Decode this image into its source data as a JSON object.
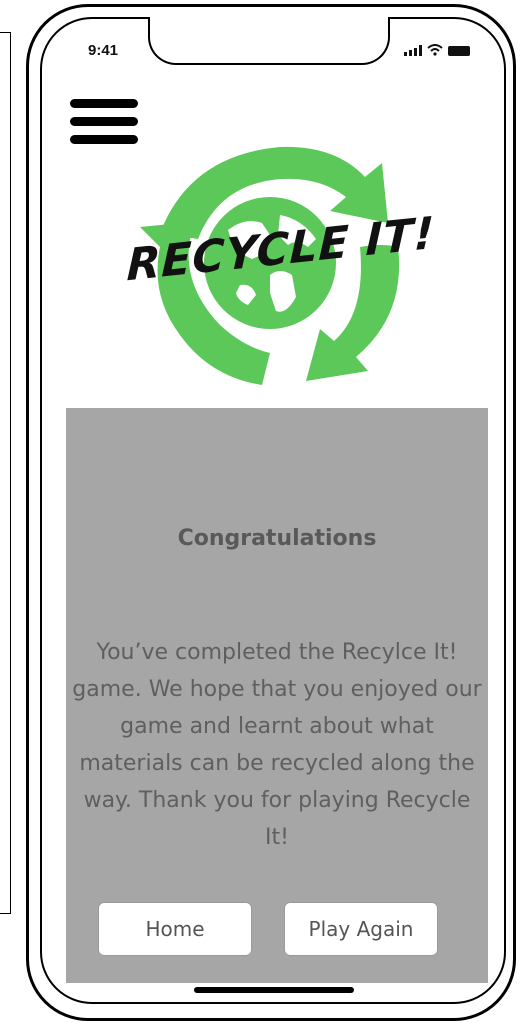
{
  "status_bar": {
    "time": "9:41"
  },
  "header": {
    "menu_icon": "hamburger-menu-icon",
    "logo_text": "RECYCLE IT!",
    "logo_color": "#5cc85a"
  },
  "card": {
    "title": "Congratulations",
    "body": "You’ve completed the Recylce It! game. We hope that you enjoyed our game and learnt about what materials can be recycled along the way. Thank you for playing Recycle It!",
    "background_color": "#a6a6a6"
  },
  "buttons": {
    "home_label": "Home",
    "play_again_label": "Play Again"
  }
}
